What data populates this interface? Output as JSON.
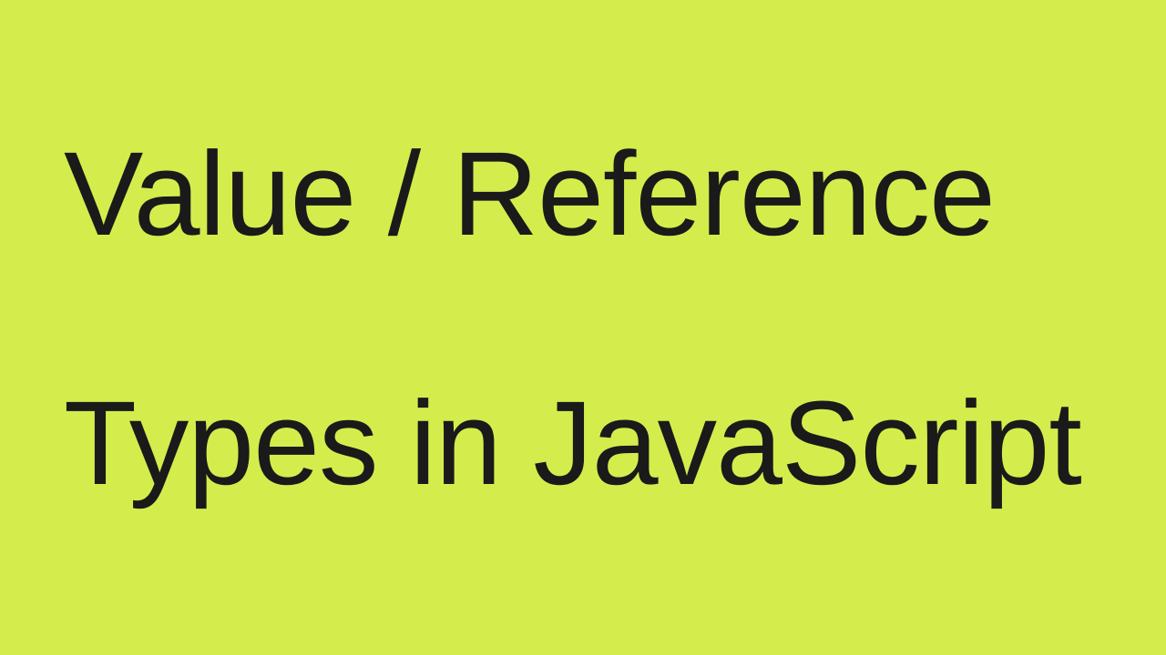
{
  "slide": {
    "line1": "Value / Reference",
    "line2": "Types in JavaScript",
    "background_color": "#d4ed4c",
    "text_color": "#1a1a1a"
  }
}
